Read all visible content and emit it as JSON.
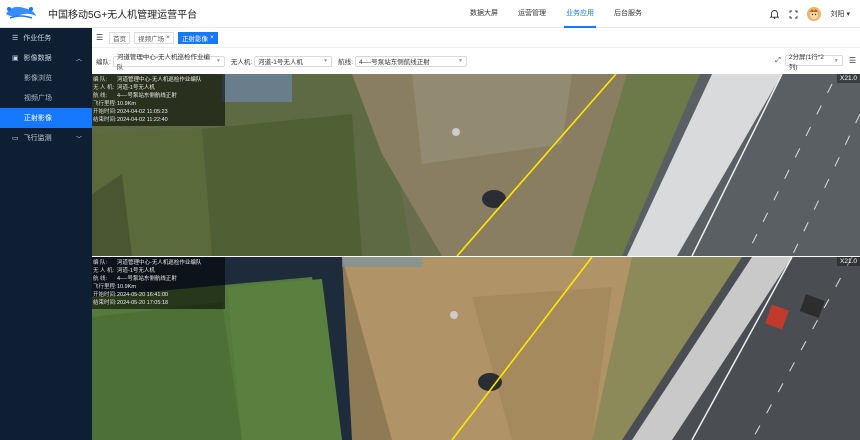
{
  "header": {
    "title": "中国移动5G+无人机管理运营平台",
    "nav": [
      "数据大屏",
      "运营管理",
      "业务应用",
      "后台服务"
    ],
    "active_nav_index": 2,
    "user_name": "刘阳"
  },
  "sidebar": {
    "items": [
      {
        "label": "作业任务"
      },
      {
        "label": "影像数据"
      },
      {
        "label": "影像浏览"
      },
      {
        "label": "视频广场"
      },
      {
        "label": "正射影像"
      },
      {
        "label": "飞行监测"
      }
    ],
    "active_sub_index": 2
  },
  "tabs": {
    "items": [
      {
        "label": "首页",
        "closable": false
      },
      {
        "label": "视频广场",
        "closable": true
      },
      {
        "label": "正射影像",
        "closable": true
      }
    ],
    "active_index": 2
  },
  "filters": {
    "team": {
      "label": "编队:",
      "value": "河道管理中心-无人机巡检作业编队"
    },
    "drone": {
      "label": "无人机:",
      "value": "河道-1号无人机"
    },
    "route": {
      "label": "航线:",
      "value": "4—-号泵站东侧航线正射"
    },
    "split": {
      "value": "2分屏(1行*2列)"
    }
  },
  "panels": [
    {
      "zoom": "X21.0",
      "info": [
        {
          "k": "编    队:",
          "v": "河道管理中心-无人机巡检作业编队"
        },
        {
          "k": "无 人 机:",
          "v": "河道-1号无人机"
        },
        {
          "k": "航    线:",
          "v": "4—-号泵站东侧航线正射"
        },
        {
          "k": "飞行里程:",
          "v": "10.9Km"
        },
        {
          "k": "开始时间:",
          "v": "2024-04-02 11:05:23"
        },
        {
          "k": "结束时间:",
          "v": "2024-04-02 11:22:40"
        }
      ]
    },
    {
      "zoom": "X21.0",
      "info": [
        {
          "k": "编    队:",
          "v": "河道管理中心-无人机巡检作业编队"
        },
        {
          "k": "无 人 机:",
          "v": "河道-1号无人机"
        },
        {
          "k": "航    线:",
          "v": "4—-号泵站东侧航线正射"
        },
        {
          "k": "飞行里程:",
          "v": "10.9Km"
        },
        {
          "k": "开始时间:",
          "v": "2024-05-20 16:41:00"
        },
        {
          "k": "结束时间:",
          "v": "2024-05-20 17:05:18"
        }
      ]
    }
  ],
  "colors": {
    "accent": "#1677ff",
    "sidebar_bg": "#0f1f33",
    "route_line": "#ffe600"
  }
}
